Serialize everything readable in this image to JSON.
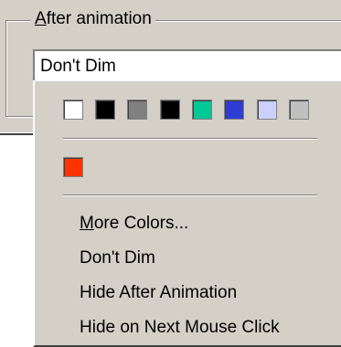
{
  "group": {
    "legend_accel": "A",
    "legend_rest": "fter animation"
  },
  "combo": {
    "value": "Don't Dim"
  },
  "dropdown": {
    "palette": [
      {
        "color": "#ffffff"
      },
      {
        "color": "#000000"
      },
      {
        "color": "#808080"
      },
      {
        "color": "#000000"
      },
      {
        "color": "#00c896"
      },
      {
        "color": "#2d3cd2"
      },
      {
        "color": "#cdd0ff"
      },
      {
        "color": "#c0c0c0"
      }
    ],
    "recent_colors": [
      {
        "color": "#ff3300"
      }
    ],
    "more_colors_accel": "M",
    "more_colors_rest": "ore Colors...",
    "items": [
      {
        "label": "Don't Dim"
      },
      {
        "label": "Hide After Animation"
      },
      {
        "label": "Hide on Next Mouse Click"
      }
    ]
  }
}
